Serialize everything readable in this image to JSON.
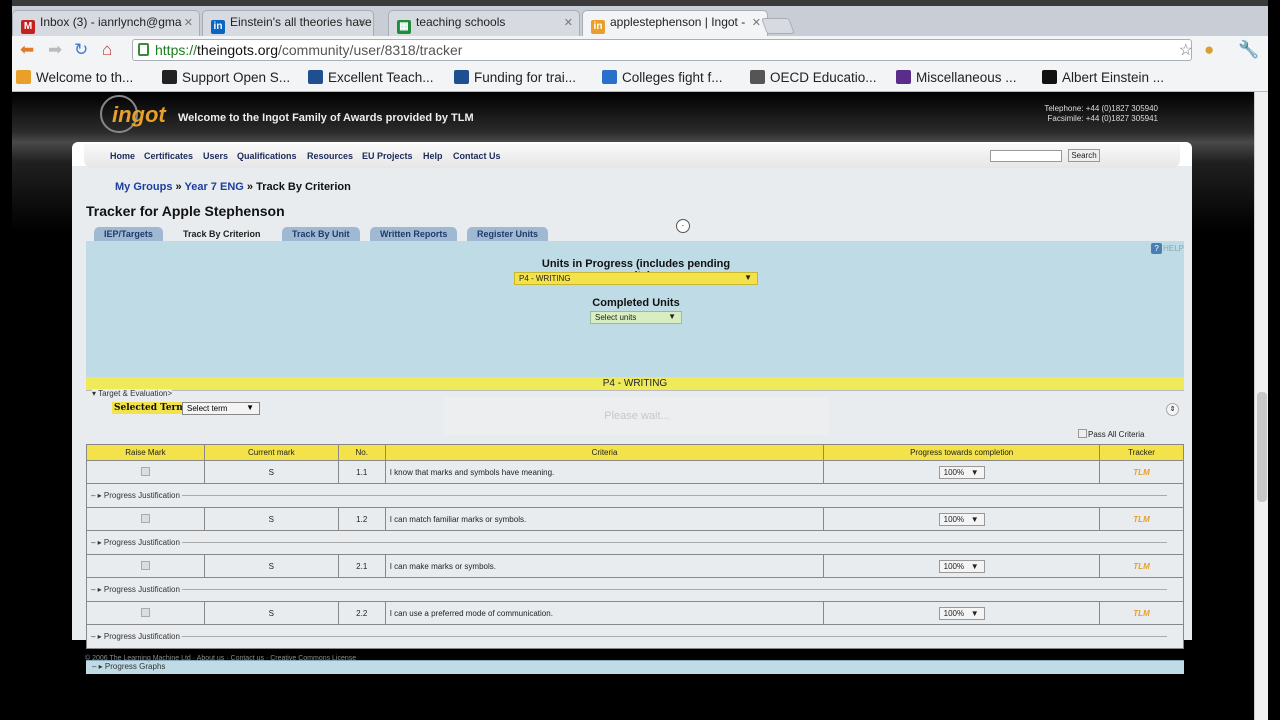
{
  "browser": {
    "tabs": [
      {
        "icon": "gmail-icon",
        "label": "Inbox (3) - ianrlynch@gma",
        "color": "#c5221f",
        "glyph": "M"
      },
      {
        "icon": "linkedin-icon",
        "label": "Einstein's all theories have",
        "color": "#0a66c2",
        "glyph": "in"
      },
      {
        "icon": "sheets-icon",
        "label": "teaching schools",
        "color": "#1e8e3e",
        "glyph": "▦"
      },
      {
        "icon": "ingot-icon",
        "label": "applestephenson | Ingot -",
        "color": "#e8a02a",
        "glyph": "in"
      }
    ],
    "url_scheme": "https://",
    "url_host": "theingots.org",
    "url_path": "/community/user/8318/tracker",
    "bookmarks": [
      {
        "icon": "ingot-icon",
        "label": "Welcome to th...",
        "color": "#e8a02a"
      },
      {
        "icon": "opensource-icon",
        "label": "Support Open S...",
        "color": "#222"
      },
      {
        "icon": "dfe-icon",
        "label": "Excellent Teach...",
        "color": "#1f4f8f"
      },
      {
        "icon": "dfe-icon",
        "label": "Funding for trai...",
        "color": "#1f4f8f"
      },
      {
        "icon": "news-icon",
        "label": "Colleges fight f...",
        "color": "#2a6fc9"
      },
      {
        "icon": "wordpress-icon",
        "label": "OECD Educatio...",
        "color": "#555"
      },
      {
        "icon": "b-icon",
        "label": "Miscellaneous ...",
        "color": "#5a2d8a"
      },
      {
        "icon": "einstein-icon",
        "label": "Albert Einstein ...",
        "color": "#111"
      }
    ]
  },
  "site": {
    "logo": "ingot",
    "welcome": "Welcome to the Ingot Family of Awards provided by TLM",
    "telephone": "Telephone: +44 (0)1827 305940",
    "facsimile": "Facsimile: +44 (0)1827 305941",
    "nav": [
      "Home",
      "Certificates",
      "Users",
      "Qualifications",
      "Resources",
      "EU Projects",
      "Help",
      "Contact Us"
    ],
    "search_button": "Search"
  },
  "breadcrumb": {
    "my_groups": "My Groups",
    "sep": "»",
    "group": "Year 7 ENG",
    "current": "Track By Criterion"
  },
  "page_title": "Tracker for Apple Stephenson",
  "page_tabs": [
    "IEP/Targets",
    "Track By Criterion",
    "Track By Unit",
    "Written Reports",
    "Register Units"
  ],
  "active_tab": "Track By Criterion",
  "help_label": "HELP",
  "units_in_progress_label": "Units in Progress (includes pending units)",
  "units_in_progress_value": "P4 - WRITING",
  "completed_units_label": "Completed Units",
  "completed_units_value": "Select units",
  "unit_bar": "P4 - WRITING",
  "target_legend": "Target & Evaluation",
  "selected_term_label": "Selected Term:",
  "selected_term_value": "Select term",
  "please_wait": "Please wait...",
  "pass_all_label": "Pass All Criteria",
  "table_headers": [
    "Raise Mark",
    "Current mark",
    "No.",
    "Criteria",
    "Progress towards completion",
    "Tracker"
  ],
  "rows": [
    {
      "mark": "S",
      "no": "1.1",
      "criteria": "I know that marks and symbols have meaning.",
      "progress": "100%",
      "tracker": "TLM"
    },
    {
      "mark": "S",
      "no": "1.2",
      "criteria": "I can match familiar marks or symbols.",
      "progress": "100%",
      "tracker": "TLM"
    },
    {
      "mark": "S",
      "no": "2.1",
      "criteria": "I can make marks or symbols.",
      "progress": "100%",
      "tracker": "TLM"
    },
    {
      "mark": "S",
      "no": "2.2",
      "criteria": "I can use a preferred mode of communication.",
      "progress": "100%",
      "tracker": "TLM"
    }
  ],
  "justification_label": "Progress Justification",
  "progress_graphs_label": "Progress Graphs",
  "footer": "© 2006 The Learning Machine Ltd · About us · Contact us · Creative Commons License"
}
